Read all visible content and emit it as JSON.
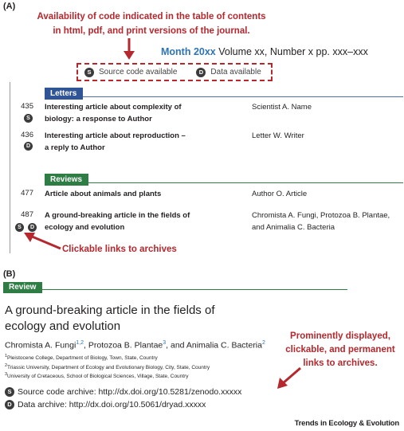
{
  "panel_a": {
    "label": "(A)",
    "callout": {
      "line1": "Availability of code indicated in the table of contents",
      "line2": "in html, pdf, and print versions of the journal."
    },
    "issue": {
      "month": "Month 20xx",
      "rest": "Volume xx, Number x  pp. xxx–xxx"
    },
    "legend": {
      "source_badge": "S",
      "source_label": "Source code available",
      "data_badge": "D",
      "data_label": "Data available"
    },
    "sections": {
      "letters": "Letters",
      "reviews": "Reviews"
    },
    "articles": [
      {
        "page": "435",
        "title_line1": "Interesting article about complexity of",
        "title_line2": "biology: a response to Author",
        "author": "Scientist A. Name"
      },
      {
        "page": "436",
        "title_line1": "Interesting article about reproduction –",
        "title_line2": "a reply to Author",
        "author": "Letter W. Writer"
      },
      {
        "page": "477",
        "title_line1": "Article about animals and plants",
        "author": "Author O. Article"
      },
      {
        "page": "487",
        "title_line1": "A ground-breaking article in the fields of",
        "title_line2": "ecology and evolution",
        "author_line1": "Chromista A. Fungi, Protozoa B. Plantae,",
        "author_line2": "and Animalia C. Bacteria"
      }
    ],
    "links_callout": "Clickable links to archives"
  },
  "panel_b": {
    "label": "(B)",
    "section": "Review",
    "title_line1": "A ground-breaking article in the fields of",
    "title_line2": "ecology and evolution",
    "authors": {
      "a1": "Chromista A. Fungi",
      "a1_sup": "1,2",
      "a2": ", Protozoa B. Plantae",
      "a2_sup": "3",
      "a3": ", and Animalia C. Bacteria",
      "a3_sup": "2"
    },
    "affiliations": [
      {
        "sup": "1",
        "text": "Pleistocene College, Department of Biology, Town, State, Country"
      },
      {
        "sup": "2",
        "text": "Triassic University, Department of Ecology and Evolutionary Biology, City, State, Country"
      },
      {
        "sup": "3",
        "text": "University of Cretaceous, School of Biological Sciences, Village, State, Country"
      }
    ],
    "callout": {
      "line1": "Prominently displayed,",
      "line2": "clickable, and permanent",
      "line3": "links to archives."
    },
    "source_link": "Source code archive: http://dx.doi.org/10.5281/zenodo.xxxxx",
    "data_link": "Data archive: http://dx.doi.org/10.5061/dryad.xxxxx"
  },
  "footer": "Trends in Ecology & Evolution",
  "colors": {
    "accent_red": "#b4282e",
    "issue_blue": "#2e74b5",
    "letters_blue": "#2f5597",
    "reviews_green": "#2e7d45",
    "badge_dark": "#3b3b3b"
  }
}
